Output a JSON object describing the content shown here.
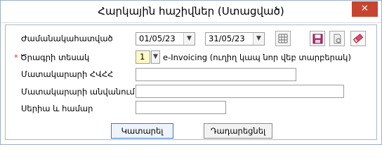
{
  "window": {
    "title": "Հարկային հաշիվներ (Ստացված)",
    "close_symbol": "✕"
  },
  "form": {
    "period": {
      "label": "Ժամանակահատված",
      "start": "01/05/23",
      "end": "31/05/23"
    },
    "doc_type": {
      "label": "Ծրագրի տեսակ",
      "required_mark": "*",
      "code": "1",
      "text": "e-Invoicing (ուղիղ կապ նոր վեբ տարբերակ)"
    },
    "supplier_tin": {
      "label": "Մատակարարի ՀՎՀՀ",
      "value": ""
    },
    "supplier_name": {
      "label": "Մատակարարի անվանում",
      "value": ""
    },
    "series_number": {
      "label": "Սերիա և համար",
      "value": ""
    }
  },
  "toolbar": {
    "icons": [
      "calendar-grid-icon",
      "save-icon",
      "settings-doc-icon",
      "eraser-icon"
    ]
  },
  "buttons": {
    "ok": "Կատարել",
    "cancel": "Դադարեցնել"
  },
  "colors": {
    "close_button": "#c7442f",
    "required": "#d63a3a",
    "code_highlight": "#fff9c4",
    "primary_border": "#3a78c6"
  }
}
